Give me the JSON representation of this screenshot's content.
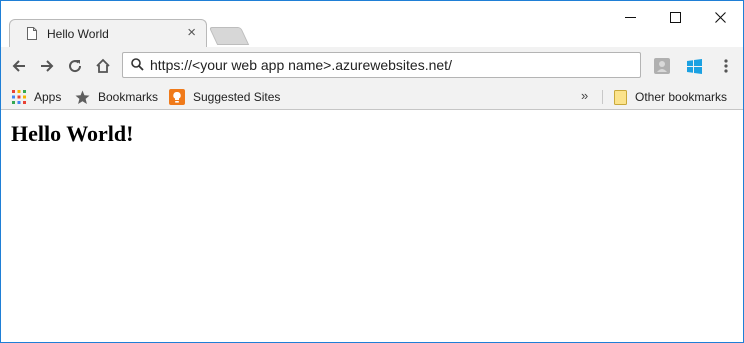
{
  "tab": {
    "title": "Hello World",
    "close_glyph": "×"
  },
  "address_bar": {
    "url": "https://<your web app name>.azurewebsites.net/"
  },
  "bookmarks": {
    "apps_label": "Apps",
    "bookmarks_label": "Bookmarks",
    "suggested_label": "Suggested Sites",
    "more_glyph": "»",
    "other_label": "Other bookmarks"
  },
  "page": {
    "heading": "Hello World!"
  },
  "colors": {
    "window_border": "#1f7fd6",
    "chrome_bg": "#f2f2f2",
    "suggested_icon": "#f07a1a",
    "windows_icon": "#1ba1e2"
  },
  "icons": [
    "page-icon",
    "close-icon",
    "minimize-icon",
    "maximize-icon",
    "window-close-icon",
    "back-icon",
    "forward-icon",
    "reload-icon",
    "home-icon",
    "search-icon",
    "profile-icon",
    "windows-icon",
    "menu-icon",
    "apps-grid-icon",
    "star-icon",
    "suggested-sites-icon",
    "folder-icon"
  ]
}
